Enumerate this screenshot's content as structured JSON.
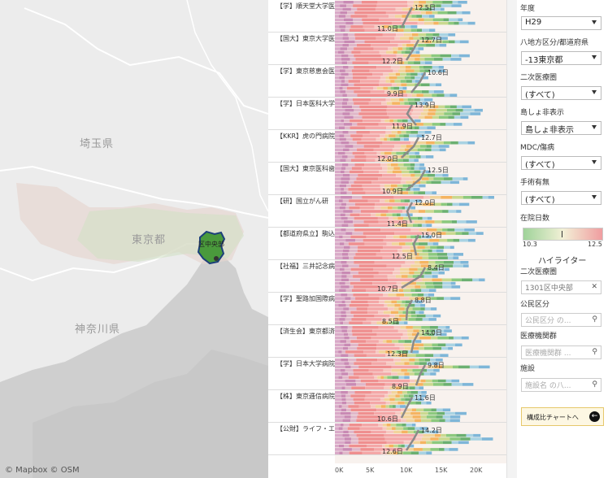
{
  "map": {
    "prefecture_labels": [
      "埼玉県",
      "東京都",
      "神奈川県"
    ],
    "selected_area_label": "区中央部",
    "attribution": [
      "© Mapbox",
      "© OSM"
    ]
  },
  "chart": {
    "rows": [
      {
        "label": "【学】順天堂大学医",
        "top_value": "12.5日",
        "bottom_value": "11.0日"
      },
      {
        "label": "【国大】東京大学医",
        "top_value": "12.7日",
        "bottom_value": "12.2日"
      },
      {
        "label": "【学】東京慈恵会医",
        "top_value": "10.6日",
        "bottom_value": "9.9日"
      },
      {
        "label": "【学】日本医科大学",
        "top_value": "13.9日",
        "bottom_value": "11.9日"
      },
      {
        "label": "【KKR】虎の門病院",
        "top_value": "12.7日",
        "bottom_value": "12.0日"
      },
      {
        "label": "【国大】東京医科歯",
        "top_value": "12.5日",
        "bottom_value": "10.9日"
      },
      {
        "label": "【研】国立がん研",
        "top_value": "12.0日",
        "bottom_value": "11.4日"
      },
      {
        "label": "【都道府県立】駒込",
        "top_value": "15.0日",
        "bottom_value": "12.5日"
      },
      {
        "label": "【社福】三井記念病",
        "top_value": "8.4日",
        "bottom_value": "10.7日"
      },
      {
        "label": "【学】聖路加国際病",
        "top_value": "8.8日",
        "bottom_value": "8.5日"
      },
      {
        "label": "【済生会】東京都済",
        "top_value": "14.0日",
        "bottom_value": "12.3日"
      },
      {
        "label": "【学】日本大学病院",
        "top_value": "9.8日",
        "bottom_value": "8.9日"
      },
      {
        "label": "【株】東京逓信病院",
        "top_value": "11.6日",
        "bottom_value": "10.6日"
      },
      {
        "label": "【公財】ライフ・エ",
        "top_value": "14.2日",
        "bottom_value": "12.6日"
      }
    ],
    "x_ticks": [
      "0K",
      "5K",
      "10K",
      "15K",
      "20K"
    ],
    "x_max": 22000
  },
  "filters": {
    "year": {
      "label": "年度",
      "value": "H29"
    },
    "region": {
      "label": "八地方区分/都道府県",
      "value": "-13東京都"
    },
    "secondary_area": {
      "label": "二次医療圏",
      "value": "(すべて)"
    },
    "island": {
      "label": "島しょ非表示",
      "value": "島しょ非表示"
    },
    "mdc": {
      "label": "MDC/傷病",
      "value": "(すべて)"
    },
    "surgery": {
      "label": "手術有無",
      "value": "(すべて)"
    }
  },
  "legend": {
    "title": "在院日数",
    "min": "10.3",
    "max": "12.5",
    "colors": {
      "low": "#9fd39a",
      "mid": "#f2f0d6",
      "high": "#f09da0"
    }
  },
  "highlighter": {
    "title": "ハイライター",
    "secondary_area": {
      "label": "二次医療圏",
      "value": "1301区中央部"
    },
    "public": {
      "label": "公民区分",
      "placeholder": "公民区分 の..."
    },
    "group": {
      "label": "医療機関群",
      "placeholder": "医療機関群 ..."
    },
    "facility": {
      "label": "施設",
      "placeholder": "施設名 の八..."
    }
  },
  "nav_button": {
    "label": "構成比チャートへ"
  },
  "colors": {
    "panel_border": "#bbb",
    "segment_palette": [
      "#d9a9c8",
      "#c98ab4",
      "#e0b7c9",
      "#ef8f8f",
      "#f4a7a7",
      "#f7c7c0",
      "#f2d49b",
      "#f5b461",
      "#c9d98f",
      "#8cc97e",
      "#6bb071",
      "#a9d3e3",
      "#7eb6d8"
    ]
  }
}
